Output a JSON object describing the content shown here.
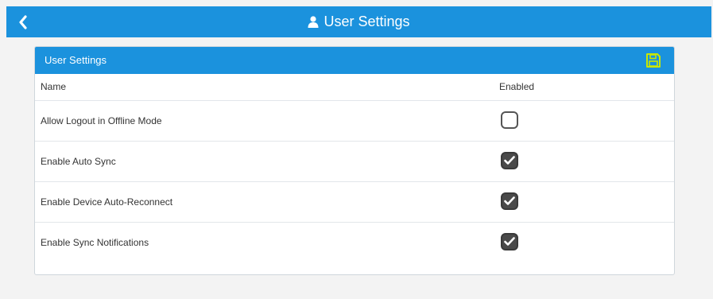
{
  "topbar": {
    "title": "User Settings",
    "back_icon": "chevron-left-icon",
    "user_icon": "user-icon",
    "color": "#1b92dd"
  },
  "card": {
    "title": "User Settings",
    "save_icon": "save-icon",
    "save_icon_color": "#c8e600",
    "columns": {
      "name": "Name",
      "enabled": "Enabled"
    },
    "settings": [
      {
        "label": "Allow Logout in Offline Mode",
        "enabled": false
      },
      {
        "label": "Enable Auto Sync",
        "enabled": true
      },
      {
        "label": "Enable Device Auto-Reconnect",
        "enabled": true
      },
      {
        "label": "Enable Sync Notifications",
        "enabled": true
      }
    ]
  }
}
